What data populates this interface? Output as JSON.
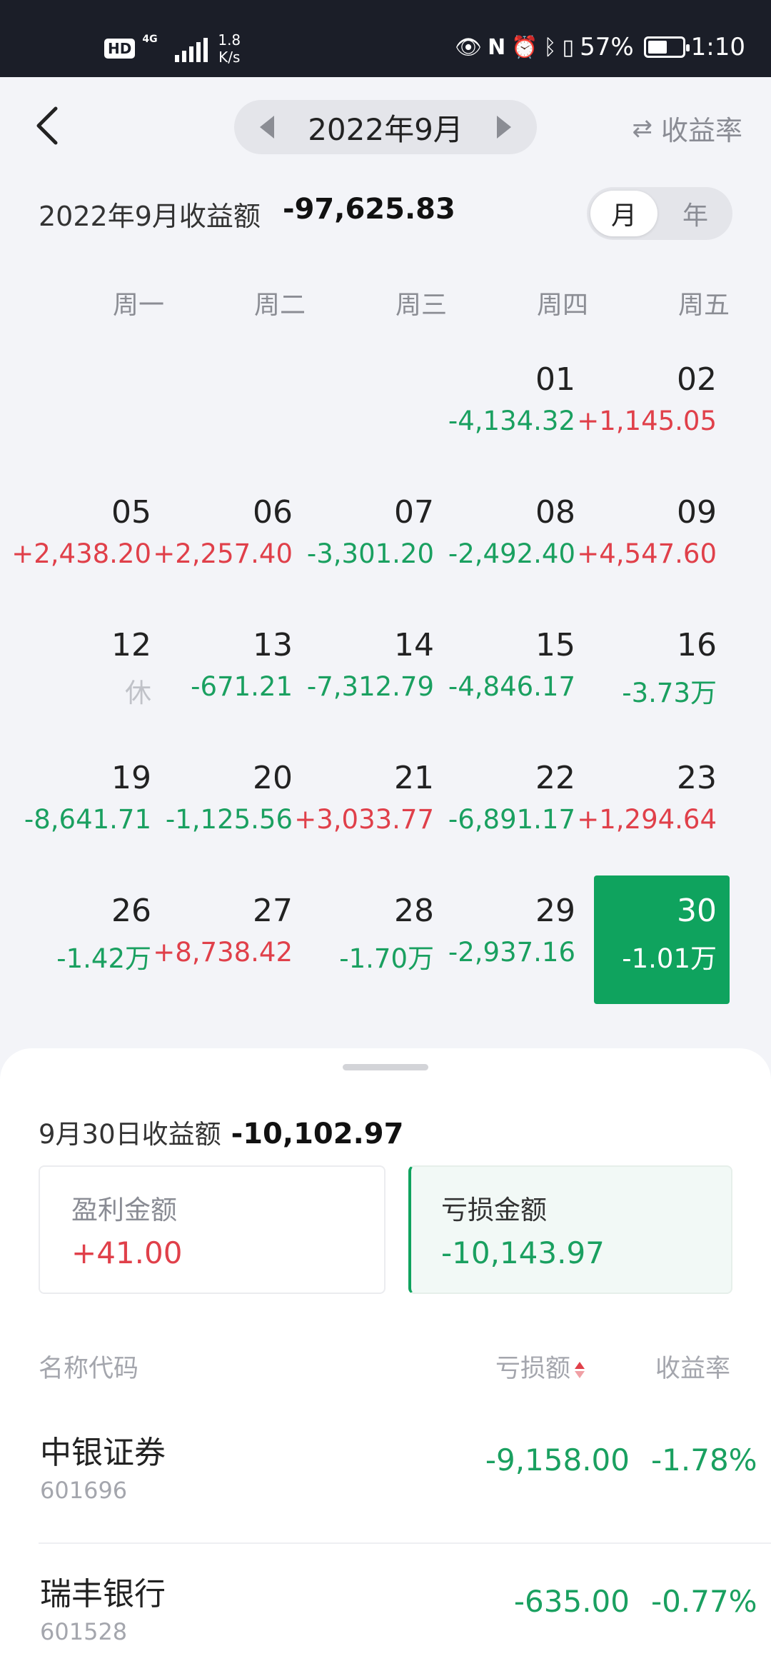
{
  "status_bar": {
    "hd": "HD",
    "network_type": "4G",
    "net_speed_value": "1.8",
    "net_speed_unit": "K/s",
    "battery_text": "57%",
    "battery_level": 0.57,
    "time": "1:10"
  },
  "header": {
    "month": "2022年9月",
    "rate_toggle": "收益率"
  },
  "summary": {
    "label": "2022年9月收益额",
    "value": "-97,625.83",
    "seg_month": "月",
    "seg_year": "年"
  },
  "weekdays": [
    "周一",
    "周二",
    "周三",
    "周四",
    "周五"
  ],
  "calendar": [
    [
      {
        "day": "",
        "value": "",
        "type": ""
      },
      {
        "day": "",
        "value": "",
        "type": ""
      },
      {
        "day": "",
        "value": "",
        "type": ""
      },
      {
        "day": "01",
        "value": "-4,134.32",
        "type": "neg"
      },
      {
        "day": "02",
        "value": "+1,145.05",
        "type": "pos"
      }
    ],
    [
      {
        "day": "05",
        "value": "+2,438.20",
        "type": "pos"
      },
      {
        "day": "06",
        "value": "+2,257.40",
        "type": "pos"
      },
      {
        "day": "07",
        "value": "-3,301.20",
        "type": "neg"
      },
      {
        "day": "08",
        "value": "-2,492.40",
        "type": "neg"
      },
      {
        "day": "09",
        "value": "+4,547.60",
        "type": "pos"
      }
    ],
    [
      {
        "day": "12",
        "value": "休",
        "type": "rest"
      },
      {
        "day": "13",
        "value": "-671.21",
        "type": "neg"
      },
      {
        "day": "14",
        "value": "-7,312.79",
        "type": "neg"
      },
      {
        "day": "15",
        "value": "-4,846.17",
        "type": "neg"
      },
      {
        "day": "16",
        "value": "-3.73万",
        "type": "neg"
      }
    ],
    [
      {
        "day": "19",
        "value": "-8,641.71",
        "type": "neg"
      },
      {
        "day": "20",
        "value": "-1,125.56",
        "type": "neg"
      },
      {
        "day": "21",
        "value": "+3,033.77",
        "type": "pos"
      },
      {
        "day": "22",
        "value": "-6,891.17",
        "type": "neg"
      },
      {
        "day": "23",
        "value": "+1,294.64",
        "type": "pos"
      }
    ],
    [
      {
        "day": "26",
        "value": "-1.42万",
        "type": "neg"
      },
      {
        "day": "27",
        "value": "+8,738.42",
        "type": "pos"
      },
      {
        "day": "28",
        "value": "-1.70万",
        "type": "neg"
      },
      {
        "day": "29",
        "value": "-2,937.16",
        "type": "neg"
      },
      {
        "day": "30",
        "value": "-1.01万",
        "type": "neg",
        "selected": true
      }
    ]
  ],
  "detail": {
    "summary_label": "9月30日收益额",
    "summary_value": "-10,102.97",
    "profit_label": "盈利金额",
    "profit_value": "+41.00",
    "loss_label": "亏损金额",
    "loss_value": "-10,143.97"
  },
  "table": {
    "col_name": "名称代码",
    "col_amount": "亏损额",
    "col_rate": "收益率",
    "rows": [
      {
        "name": "中银证券",
        "code": "601696",
        "amount": "-9,158.00",
        "rate": "-1.78%"
      },
      {
        "name": "瑞丰银行",
        "code": "601528",
        "amount": "-635.00",
        "rate": "-0.77%"
      }
    ]
  },
  "colors": {
    "gain": "#e0404a",
    "loss": "#1aa060",
    "selected_bg": "#0fa35e"
  }
}
